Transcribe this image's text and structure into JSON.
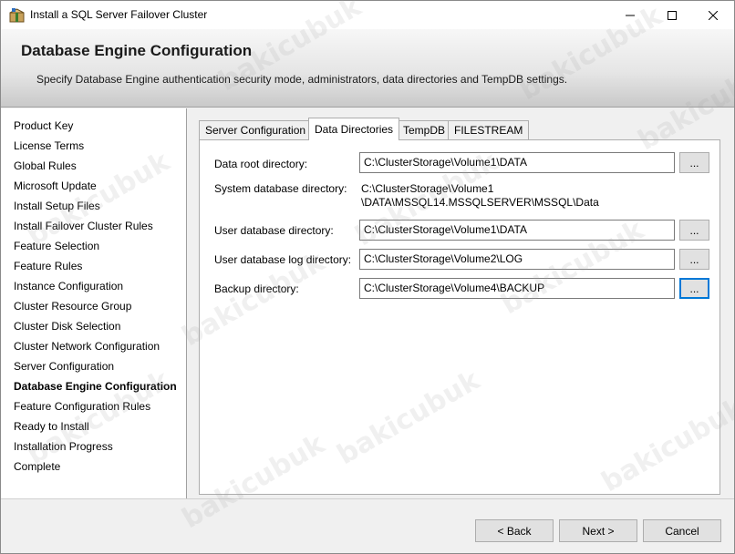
{
  "window": {
    "title": "Install a SQL Server Failover Cluster",
    "controls": {
      "minimize": "–",
      "maximize": "☐",
      "close": "✕"
    }
  },
  "header": {
    "title": "Database Engine Configuration",
    "description": "Specify Database Engine authentication security mode, administrators, data directories and TempDB settings."
  },
  "sidebar": {
    "items": [
      {
        "label": "Product Key"
      },
      {
        "label": "License Terms"
      },
      {
        "label": "Global Rules"
      },
      {
        "label": "Microsoft Update"
      },
      {
        "label": "Install Setup Files"
      },
      {
        "label": "Install Failover Cluster Rules"
      },
      {
        "label": "Feature Selection"
      },
      {
        "label": "Feature Rules"
      },
      {
        "label": "Instance Configuration"
      },
      {
        "label": "Cluster Resource Group"
      },
      {
        "label": "Cluster Disk Selection"
      },
      {
        "label": "Cluster Network Configuration"
      },
      {
        "label": "Server Configuration"
      },
      {
        "label": "Database Engine Configuration",
        "active": true
      },
      {
        "label": "Feature Configuration Rules"
      },
      {
        "label": "Ready to Install"
      },
      {
        "label": "Installation Progress"
      },
      {
        "label": "Complete"
      }
    ]
  },
  "tabs": [
    {
      "label": "Server Configuration"
    },
    {
      "label": "Data Directories",
      "selected": true
    },
    {
      "label": "TempDB"
    },
    {
      "label": "FILESTREAM"
    }
  ],
  "directories": {
    "data_root": {
      "label": "Data root directory:",
      "value": "C:\\ClusterStorage\\Volume1\\DATA"
    },
    "system_db": {
      "label": "System database directory:",
      "value_line1": "C:\\ClusterStorage\\Volume1",
      "value_line2": "\\DATA\\MSSQL14.MSSQLSERVER\\MSSQL\\Data"
    },
    "user_db": {
      "label": "User database directory:",
      "value": "C:\\ClusterStorage\\Volume1\\DATA"
    },
    "user_db_log": {
      "label": "User database log directory:",
      "value": "C:\\ClusterStorage\\Volume2\\LOG"
    },
    "backup": {
      "label": "Backup directory:",
      "value": "C:\\ClusterStorage\\Volume4\\BACKUP"
    },
    "browse_label": "..."
  },
  "footer": {
    "back": "< Back",
    "next": "Next >",
    "cancel": "Cancel"
  },
  "watermark": "bakicubuk"
}
